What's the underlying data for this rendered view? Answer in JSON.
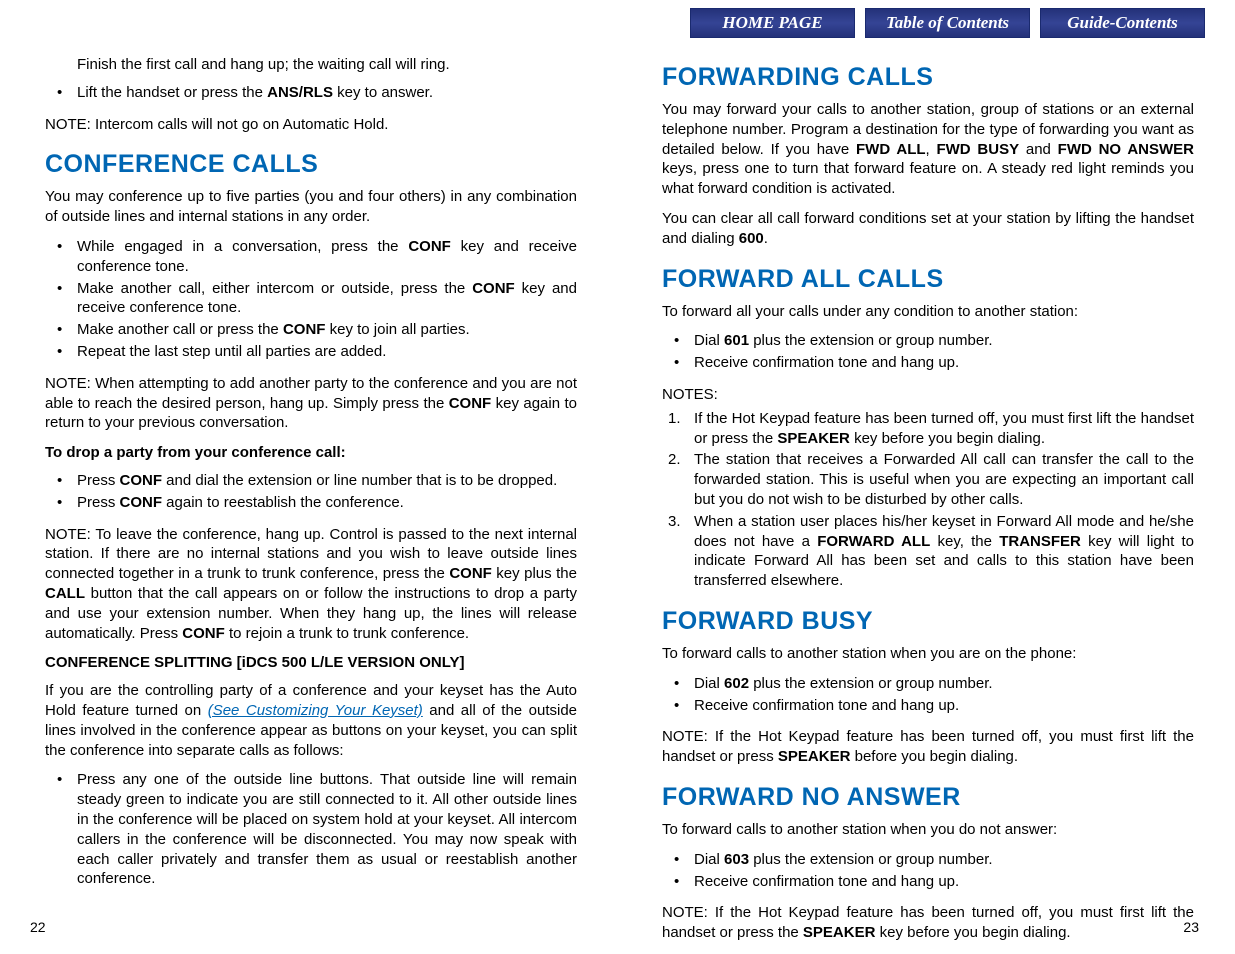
{
  "nav": {
    "home": "HOME PAGE",
    "toc": "Table of Contents",
    "guide": "Guide-Contents"
  },
  "left": {
    "intro_line": "Finish the first call and hang up; the waiting call will ring.",
    "intro_bullet_pre": "Lift the handset or press the ",
    "intro_bullet_key": "ANS/RLS",
    "intro_bullet_post": " key to answer.",
    "intro_note": "NOTE: Intercom calls will not go on Automatic Hold.",
    "h_conf": "CONFERENCE CALLS",
    "conf_p1": "You may conference up to five parties (you and four others) in any combination of outside lines and internal stations in any order.",
    "conf_b1_a": "While engaged in a conversation, press the ",
    "conf_b1_k": "CONF",
    "conf_b1_b": " key and receive conference tone.",
    "conf_b2_a": "Make another call, either intercom or outside, press the ",
    "conf_b2_k": "CONF",
    "conf_b2_b": " key and receive conference tone.",
    "conf_b3_a": "Make another call or press the ",
    "conf_b3_k": "CONF",
    "conf_b3_b": " key to join all parties.",
    "conf_b4": "Repeat the last step until all parties are added.",
    "conf_note1_a": "NOTE:  When attempting to add another party to the conference and you are not able to reach the desired person, hang up. Simply press the ",
    "conf_note1_k": "CONF",
    "conf_note1_b": " key again to return to your previous conversation.",
    "drop_h": "To drop a party from your conference call:",
    "drop_b1_a": "Press ",
    "drop_b1_k": "CONF",
    "drop_b1_b": " and dial the extension or line number that is to be dropped.",
    "drop_b2_a": "Press ",
    "drop_b2_k": "CONF",
    "drop_b2_b": " again to reestablish the conference.",
    "leave_a": "NOTE: To leave the conference, hang up. Control is passed to the next internal station. If there are no internal stations and you wish to leave outside lines connected together in a trunk to trunk conference, press the ",
    "leave_k1": "CONF",
    "leave_b": " key plus the ",
    "leave_k2": "CALL",
    "leave_c": " button that the call appears on or follow the instructions to drop a party and use your extension number. When they hang up, the lines will release automatically. Press ",
    "leave_k3": "CONF",
    "leave_d": " to rejoin a trunk to trunk conference.",
    "split_h": "CONFERENCE SPLITTING [iDCS 500 L/LE VERSION ONLY]",
    "split_p_a": "If you are the controlling party of a conference and your keyset has the Auto Hold feature turned on ",
    "split_link": "(See Customizing Your Keyset)",
    "split_p_b": " and all of the outside lines involved in the conference appear as buttons on your keyset, you can split the conference into separate calls as follows:",
    "split_b1": "Press any one of the outside line buttons. That outside line will remain steady green to indicate you are still connected to it. All other outside lines in the conference will be placed on system hold at your keyset. All intercom callers in the conference will be disconnected. You may now speak with each caller privately and transfer them as usual or reestablish another conference.",
    "pagenum": "22"
  },
  "right": {
    "h_fwd": "FORWARDING CALLS",
    "fwd_p1_a": "You may forward your calls to another station, group of stations or an external telephone number. Program a destination for the type of forwarding you want as detailed below. If you have ",
    "fwd_k1": "FWD ALL",
    "fwd_sep1": ", ",
    "fwd_k2": "FWD BUSY",
    "fwd_sep2": " and ",
    "fwd_k3": "FWD NO ANSWER",
    "fwd_p1_b": " keys, press one to turn that forward feature on. A steady red light reminds you what forward condition is activated.",
    "fwd_p2_a": "You can clear all call forward conditions set at your station by lifting the handset and dialing ",
    "fwd_p2_k": "600",
    "fwd_p2_b": ".",
    "h_all": "FORWARD ALL CALLS",
    "all_p1": "To forward all your calls under any condition to another station:",
    "all_b1_a": "Dial ",
    "all_b1_k": "601",
    "all_b1_b": " plus the extension or group number.",
    "all_b2": "Receive confirmation tone and hang up.",
    "notes_label": "NOTES:",
    "all_n1_a": "If the Hot Keypad feature has been turned off, you must first lift the handset or press the ",
    "all_n1_k": "SPEAKER",
    "all_n1_b": " key before you begin dialing.",
    "all_n2": "The station that receives a Forwarded All call can transfer the call to the forwarded station. This is useful when you are expecting an important call but you do not wish to be disturbed by other calls.",
    "all_n3_a": "When a station user places his/her keyset in Forward All mode and he/she does not have a ",
    "all_n3_k1": "FORWARD ALL",
    "all_n3_b": " key, the ",
    "all_n3_k2": "TRANSFER",
    "all_n3_c": " key will light to indicate Forward All has been set and calls to this station have been transferred elsewhere.",
    "h_busy": "FORWARD BUSY",
    "busy_p1": "To forward calls to another station when you are on the phone:",
    "busy_b1_a": "Dial ",
    "busy_b1_k": "602",
    "busy_b1_b": " plus the extension or group number.",
    "busy_b2": "Receive confirmation tone and hang up.",
    "busy_note_a": "NOTE:  If the Hot Keypad feature has been turned off, you must first lift the handset or press ",
    "busy_note_k": "SPEAKER",
    "busy_note_b": " before you begin dialing.",
    "h_noans": "FORWARD NO ANSWER",
    "noans_p1": "To forward calls to another station when you do not answer:",
    "noans_b1_a": "Dial ",
    "noans_b1_k": "603",
    "noans_b1_b": " plus the extension or group number.",
    "noans_b2": "Receive confirmation tone and hang up.",
    "noans_note_a": "NOTE:  If the Hot Keypad feature has been turned off, you must first lift the handset or press the ",
    "noans_note_k": "SPEAKER",
    "noans_note_b": " key before you begin dialing.",
    "pagenum": "23"
  }
}
